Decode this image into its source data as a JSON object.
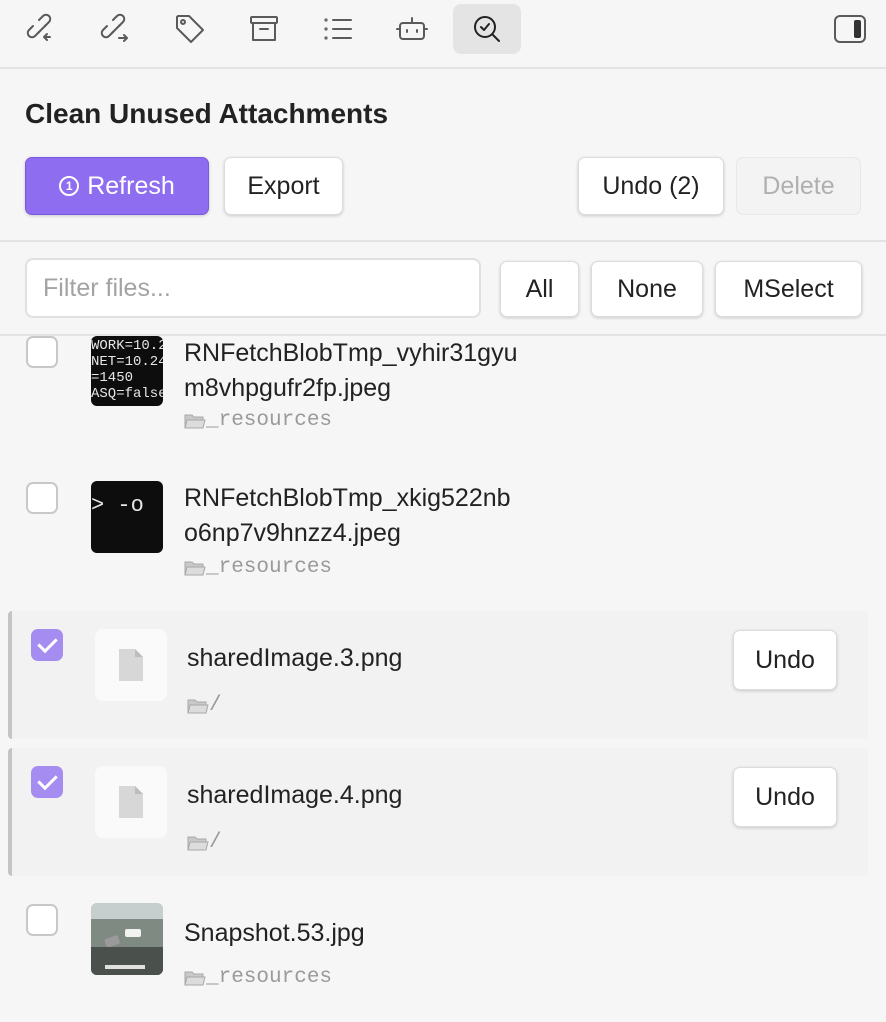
{
  "toolbar": {
    "icons": [
      "link-in-icon",
      "link-out-icon",
      "tag-icon",
      "archive-icon",
      "list-icon",
      "robot-icon",
      "search-check-icon",
      "sidebar-toggle-icon"
    ],
    "active": "search-check-icon"
  },
  "panel": {
    "title": "Clean Unused Attachments",
    "refresh_label": "Refresh",
    "export_label": "Export",
    "undo_label": "Undo (2)",
    "delete_label": "Delete"
  },
  "filter": {
    "placeholder": "Filter files...",
    "value": "",
    "all_label": "All",
    "none_label": "None",
    "mselect_label": "MSelect"
  },
  "files": [
    {
      "name_line1": "RNFetchBlobTmp_vyhir31gyu",
      "name_line2": "m8vhpgufr2fp.jpeg",
      "path": "_resources",
      "checked": false,
      "thumb_text": "WORK=10.2\nNET=10.24\n=1450\nASQ=false"
    },
    {
      "name_line1": "RNFetchBlobTmp_xkig522nb",
      "name_line2": "o6np7v9hnzz4.jpeg",
      "path": "_resources",
      "checked": false,
      "thumb_text": "> -o"
    },
    {
      "name": "sharedImage.3.png",
      "path": "/",
      "checked": true,
      "undo_label": "Undo"
    },
    {
      "name": "sharedImage.4.png",
      "path": "/",
      "checked": true,
      "undo_label": "Undo"
    },
    {
      "name": "Snapshot.53.jpg",
      "path": "_resources",
      "checked": false
    }
  ],
  "colors": {
    "accent": "#8f6df0",
    "checkbox_on": "#a48cf0"
  }
}
